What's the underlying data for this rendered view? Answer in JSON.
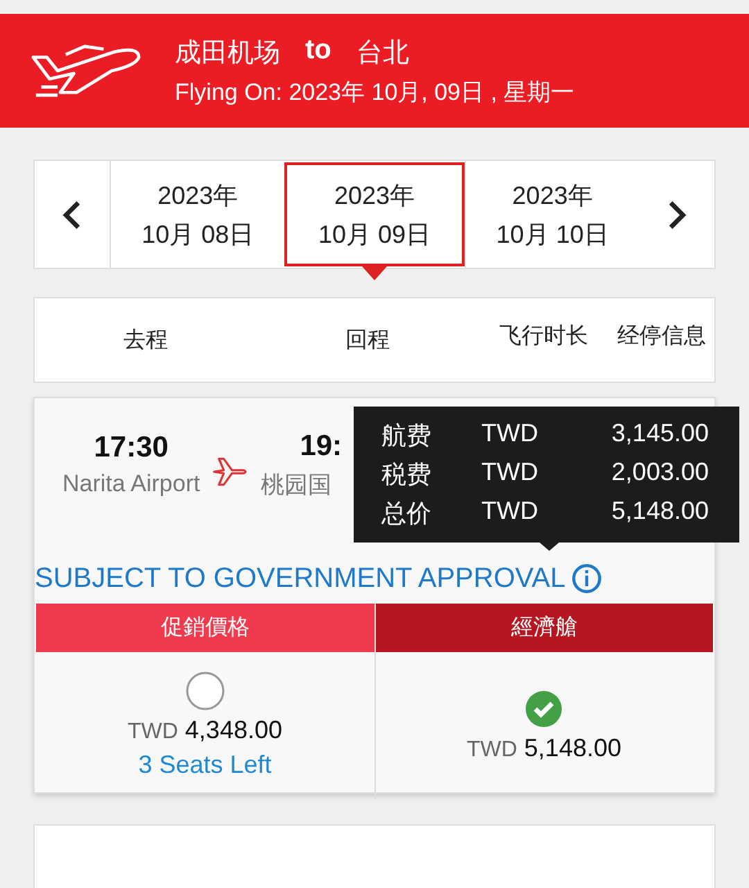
{
  "header": {
    "route_from": "成田机场",
    "route_to_word": "to",
    "route_to": "台北",
    "flying_on": "Flying On: 2023年 10月, 09日 , 星期一"
  },
  "dates": [
    {
      "year": "2023年",
      "day": "10月 08日",
      "selected": false
    },
    {
      "year": "2023年",
      "day": "10月 09日",
      "selected": true
    },
    {
      "year": "2023年",
      "day": "10月 10日",
      "selected": false
    }
  ],
  "columns": [
    "去程",
    "回程",
    "飞行时长",
    "经停信息"
  ],
  "flight": {
    "depart_time": "17:30",
    "depart_airport": "Narita Airport",
    "arrive_time": "19:",
    "arrive_airport": "桃园国"
  },
  "tooltip": [
    {
      "label": "航费",
      "currency": "TWD",
      "amount": "3,145.00"
    },
    {
      "label": "税费",
      "currency": "TWD",
      "amount": "2,003.00"
    },
    {
      "label": "总价",
      "currency": "TWD",
      "amount": "5,148.00"
    }
  ],
  "approval": "SUBJECT TO GOVERNMENT APPROVAL",
  "fares": [
    {
      "name": "促銷價格",
      "color": "#f03a4e",
      "selected": false,
      "currency": "TWD",
      "amount": "4,348.00",
      "seats": "3 Seats Left"
    },
    {
      "name": "經濟艙",
      "color": "#b5161f",
      "selected": true,
      "currency": "TWD",
      "amount": "5,148.00"
    }
  ]
}
